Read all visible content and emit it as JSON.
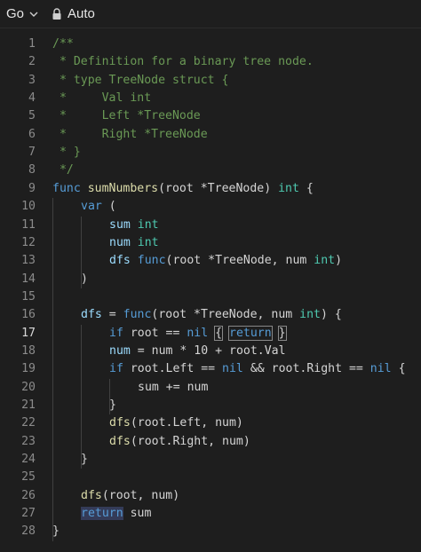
{
  "topbar": {
    "language": "Go",
    "mode": "Auto"
  },
  "editor": {
    "active_line": 17,
    "lines": [
      {
        "n": "1",
        "indent": 0,
        "tokens": [
          {
            "t": "/**",
            "c": "cm"
          }
        ]
      },
      {
        "n": "2",
        "indent": 0,
        "tokens": [
          {
            "t": " * Definition for a binary tree node.",
            "c": "cm"
          }
        ]
      },
      {
        "n": "3",
        "indent": 0,
        "tokens": [
          {
            "t": " * type TreeNode struct {",
            "c": "cm"
          }
        ]
      },
      {
        "n": "4",
        "indent": 0,
        "tokens": [
          {
            "t": " *     Val int",
            "c": "cm"
          }
        ]
      },
      {
        "n": "5",
        "indent": 0,
        "tokens": [
          {
            "t": " *     Left *TreeNode",
            "c": "cm"
          }
        ]
      },
      {
        "n": "6",
        "indent": 0,
        "tokens": [
          {
            "t": " *     Right *TreeNode",
            "c": "cm"
          }
        ]
      },
      {
        "n": "7",
        "indent": 0,
        "tokens": [
          {
            "t": " * }",
            "c": "cm"
          }
        ]
      },
      {
        "n": "8",
        "indent": 0,
        "tokens": [
          {
            "t": " */",
            "c": "cm"
          }
        ]
      },
      {
        "n": "9",
        "indent": 0,
        "tokens": [
          {
            "t": "func ",
            "c": "kw"
          },
          {
            "t": "sumNumbers",
            "c": "fn"
          },
          {
            "t": "(root *TreeNode) ",
            "c": "pl"
          },
          {
            "t": "int",
            "c": "tp"
          },
          {
            "t": " {",
            "c": "pl"
          }
        ]
      },
      {
        "n": "10",
        "indent": 1,
        "tokens": [
          {
            "t": "var",
            "c": "kw"
          },
          {
            "t": " (",
            "c": "pl"
          }
        ]
      },
      {
        "n": "11",
        "indent": 2,
        "tokens": [
          {
            "t": "sum",
            "c": "vr"
          },
          {
            "t": " ",
            "c": "pl"
          },
          {
            "t": "int",
            "c": "tp"
          }
        ]
      },
      {
        "n": "12",
        "indent": 2,
        "tokens": [
          {
            "t": "num",
            "c": "vr"
          },
          {
            "t": " ",
            "c": "pl"
          },
          {
            "t": "int",
            "c": "tp"
          }
        ]
      },
      {
        "n": "13",
        "indent": 2,
        "tokens": [
          {
            "t": "dfs",
            "c": "vr"
          },
          {
            "t": " ",
            "c": "pl"
          },
          {
            "t": "func",
            "c": "kw"
          },
          {
            "t": "(root *TreeNode, num ",
            "c": "pl"
          },
          {
            "t": "int",
            "c": "tp"
          },
          {
            "t": ")",
            "c": "pl"
          }
        ]
      },
      {
        "n": "14",
        "indent": 1,
        "tokens": [
          {
            "t": ")",
            "c": "pl"
          }
        ]
      },
      {
        "n": "15",
        "indent": 0,
        "tokens": []
      },
      {
        "n": "16",
        "indent": 1,
        "tokens": [
          {
            "t": "dfs",
            "c": "vr"
          },
          {
            "t": " = ",
            "c": "pl"
          },
          {
            "t": "func",
            "c": "kw"
          },
          {
            "t": "(root *TreeNode, num ",
            "c": "pl"
          },
          {
            "t": "int",
            "c": "tp"
          },
          {
            "t": ") {",
            "c": "pl"
          }
        ]
      },
      {
        "n": "17",
        "indent": 2,
        "tokens": [
          {
            "t": "if",
            "c": "kw"
          },
          {
            "t": " root == ",
            "c": "pl"
          },
          {
            "t": "nil",
            "c": "kw"
          },
          {
            "t": " ",
            "c": "pl"
          },
          {
            "t": "{",
            "c": "pl",
            "box": true
          },
          {
            "t": " ",
            "c": "pl"
          },
          {
            "t": "return",
            "c": "kw",
            "box": true
          },
          {
            "t": " ",
            "c": "pl"
          },
          {
            "t": "}",
            "c": "pl",
            "box": true
          }
        ]
      },
      {
        "n": "18",
        "indent": 2,
        "tokens": [
          {
            "t": "num",
            "c": "vr"
          },
          {
            "t": " = num * ",
            "c": "pl"
          },
          {
            "t": "10",
            "c": "pl"
          },
          {
            "t": " + root.Val",
            "c": "pl"
          }
        ]
      },
      {
        "n": "19",
        "indent": 2,
        "tokens": [
          {
            "t": "if",
            "c": "kw"
          },
          {
            "t": " root.Left == ",
            "c": "pl"
          },
          {
            "t": "nil",
            "c": "kw"
          },
          {
            "t": " && root.Right == ",
            "c": "pl"
          },
          {
            "t": "nil",
            "c": "kw"
          },
          {
            "t": " {",
            "c": "pl"
          }
        ]
      },
      {
        "n": "20",
        "indent": 3,
        "tokens": [
          {
            "t": "sum",
            "c": "pl"
          },
          {
            "t": " += num",
            "c": "pl"
          }
        ]
      },
      {
        "n": "21",
        "indent": 2,
        "tokens": [
          {
            "t": "}",
            "c": "pl"
          }
        ]
      },
      {
        "n": "22",
        "indent": 2,
        "tokens": [
          {
            "t": "dfs",
            "c": "fn"
          },
          {
            "t": "(root.Left, num)",
            "c": "pl"
          }
        ]
      },
      {
        "n": "23",
        "indent": 2,
        "tokens": [
          {
            "t": "dfs",
            "c": "fn"
          },
          {
            "t": "(root.Right, num)",
            "c": "pl"
          }
        ]
      },
      {
        "n": "24",
        "indent": 1,
        "tokens": [
          {
            "t": "}",
            "c": "pl"
          }
        ]
      },
      {
        "n": "25",
        "indent": 0,
        "tokens": []
      },
      {
        "n": "26",
        "indent": 1,
        "tokens": [
          {
            "t": "dfs",
            "c": "fn"
          },
          {
            "t": "(root, num)",
            "c": "pl"
          }
        ]
      },
      {
        "n": "27",
        "indent": 1,
        "tokens": [
          {
            "t": "return",
            "c": "kw",
            "hl": true
          },
          {
            "t": " sum",
            "c": "pl"
          }
        ]
      },
      {
        "n": "28",
        "indent": 0,
        "tokens": [
          {
            "t": "}",
            "c": "pl"
          }
        ]
      }
    ]
  }
}
